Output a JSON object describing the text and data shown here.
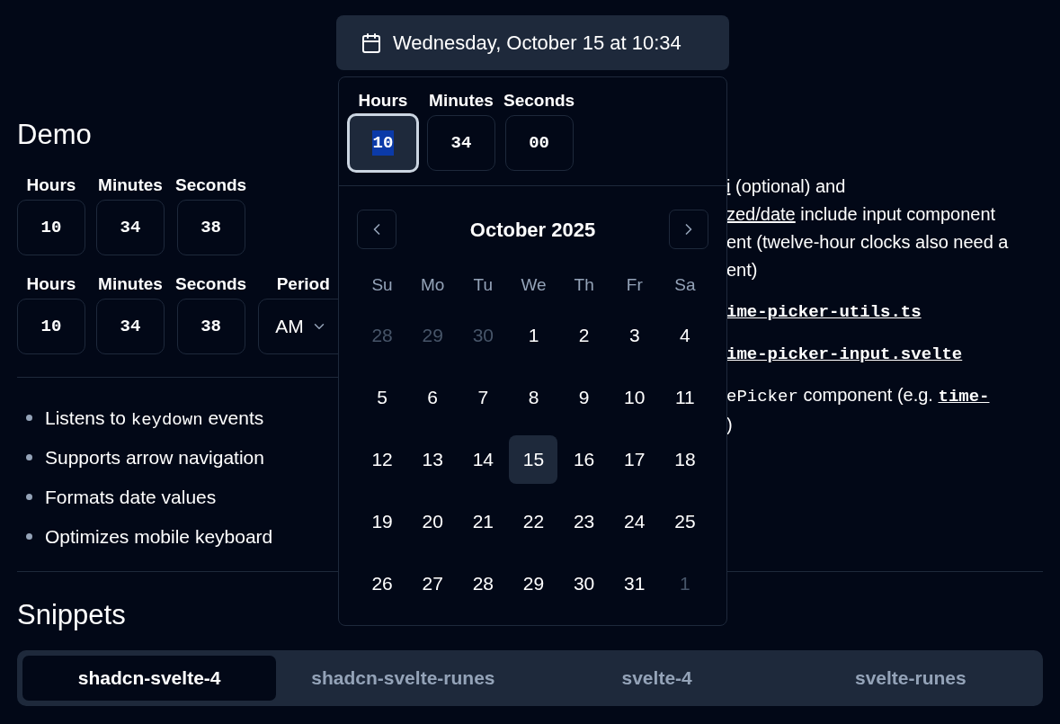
{
  "demo": {
    "heading": "Demo",
    "pickers": [
      {
        "fields": [
          {
            "label": "Hours",
            "value": "10"
          },
          {
            "label": "Minutes",
            "value": "34"
          },
          {
            "label": "Seconds",
            "value": "38"
          }
        ]
      },
      {
        "fields": [
          {
            "label": "Hours",
            "value": "10"
          },
          {
            "label": "Minutes",
            "value": "34"
          },
          {
            "label": "Seconds",
            "value": "38"
          }
        ],
        "period": {
          "label": "Period",
          "value": "AM"
        }
      }
    ]
  },
  "features": [
    {
      "before": "Listens to ",
      "code": "keydown",
      "after": " events"
    },
    {
      "before": "Supports arrow navigation"
    },
    {
      "before": "Formats date values"
    },
    {
      "before": "Optimizes mobile keyboard"
    }
  ],
  "notes": [
    [
      [
        {
          "kind": "link",
          "text": "i"
        },
        {
          "kind": "plain",
          "text": " (optional) and"
        }
      ],
      [
        {
          "kind": "link",
          "text": "zed/date"
        },
        {
          "kind": "plain",
          "text": " include input component"
        }
      ],
      [
        {
          "kind": "plain",
          "text": "ent (twelve-hour clocks also need a"
        }
      ],
      [
        {
          "kind": "plain",
          "text": "ent)"
        }
      ]
    ],
    [
      [
        {
          "kind": "code_link",
          "text": "ime-picker-utils.ts"
        }
      ]
    ],
    [
      [
        {
          "kind": "code_link",
          "text": "ime-picker-input.svelte"
        }
      ]
    ],
    [
      [
        {
          "kind": "code",
          "text": "ePicker"
        },
        {
          "kind": "plain",
          "text": " component (e.g. "
        },
        {
          "kind": "code_link",
          "text": "time-"
        }
      ],
      [
        {
          "kind": "plain",
          "text": ")"
        }
      ]
    ]
  ],
  "snippets": {
    "heading": "Snippets",
    "tabs": [
      {
        "label": "shadcn-svelte-4",
        "selected": true
      },
      {
        "label": "shadcn-svelte-runes",
        "selected": false
      },
      {
        "label": "svelte-4",
        "selected": false
      },
      {
        "label": "svelte-runes",
        "selected": false
      }
    ]
  },
  "date_picker": {
    "trigger": "Wednesday, October 15 at 10:34",
    "time_fields": [
      {
        "label": "Hours",
        "value": "10",
        "focused": true
      },
      {
        "label": "Minutes",
        "value": "34",
        "focused": false
      },
      {
        "label": "Seconds",
        "value": "00",
        "focused": false
      }
    ],
    "month": "October 2025",
    "weekdays": [
      "Su",
      "Mo",
      "Tu",
      "We",
      "Th",
      "Fr",
      "Sa"
    ],
    "weeks": [
      [
        {
          "day": "28",
          "outside": true,
          "selected": false
        },
        {
          "day": "29",
          "outside": true,
          "selected": false
        },
        {
          "day": "30",
          "outside": true,
          "selected": false
        },
        {
          "day": "1",
          "outside": false,
          "selected": false
        },
        {
          "day": "2",
          "outside": false,
          "selected": false
        },
        {
          "day": "3",
          "outside": false,
          "selected": false
        },
        {
          "day": "4",
          "outside": false,
          "selected": false
        }
      ],
      [
        {
          "day": "5",
          "outside": false,
          "selected": false
        },
        {
          "day": "6",
          "outside": false,
          "selected": false
        },
        {
          "day": "7",
          "outside": false,
          "selected": false
        },
        {
          "day": "8",
          "outside": false,
          "selected": false
        },
        {
          "day": "9",
          "outside": false,
          "selected": false
        },
        {
          "day": "10",
          "outside": false,
          "selected": false
        },
        {
          "day": "11",
          "outside": false,
          "selected": false
        }
      ],
      [
        {
          "day": "12",
          "outside": false,
          "selected": false
        },
        {
          "day": "13",
          "outside": false,
          "selected": false
        },
        {
          "day": "14",
          "outside": false,
          "selected": false
        },
        {
          "day": "15",
          "outside": false,
          "selected": true
        },
        {
          "day": "16",
          "outside": false,
          "selected": false
        },
        {
          "day": "17",
          "outside": false,
          "selected": false
        },
        {
          "day": "18",
          "outside": false,
          "selected": false
        }
      ],
      [
        {
          "day": "19",
          "outside": false,
          "selected": false
        },
        {
          "day": "20",
          "outside": false,
          "selected": false
        },
        {
          "day": "21",
          "outside": false,
          "selected": false
        },
        {
          "day": "22",
          "outside": false,
          "selected": false
        },
        {
          "day": "23",
          "outside": false,
          "selected": false
        },
        {
          "day": "24",
          "outside": false,
          "selected": false
        },
        {
          "day": "25",
          "outside": false,
          "selected": false
        }
      ],
      [
        {
          "day": "26",
          "outside": false,
          "selected": false
        },
        {
          "day": "27",
          "outside": false,
          "selected": false
        },
        {
          "day": "28",
          "outside": false,
          "selected": false
        },
        {
          "day": "29",
          "outside": false,
          "selected": false
        },
        {
          "day": "30",
          "outside": false,
          "selected": false
        },
        {
          "day": "31",
          "outside": false,
          "selected": false
        },
        {
          "day": "1",
          "outside": true,
          "selected": false
        }
      ]
    ]
  }
}
